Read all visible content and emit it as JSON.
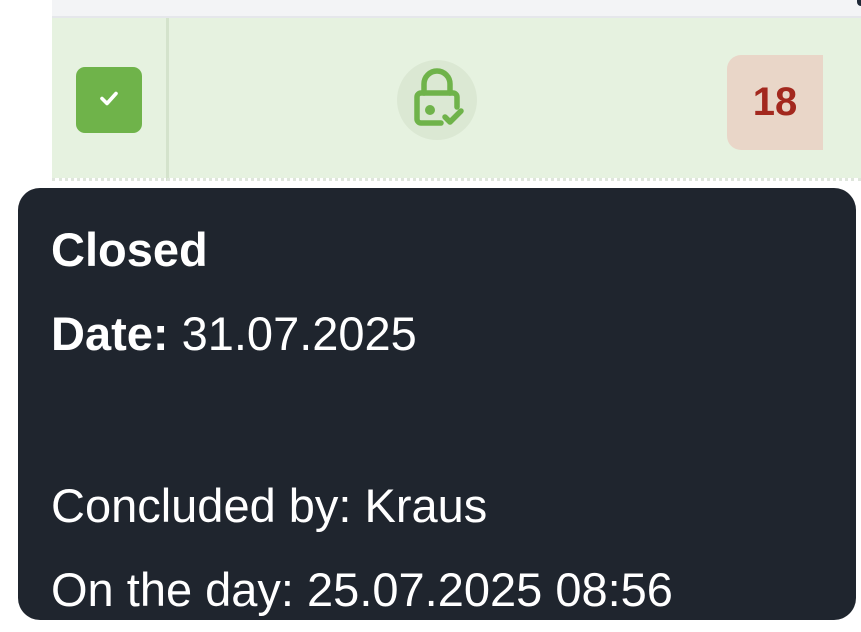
{
  "row": {
    "checkbox": {
      "checked": true,
      "icon": "check-icon",
      "color": "#6fb34a"
    },
    "lock": {
      "icon": "lock-check-icon",
      "color": "#6fb34a"
    },
    "count": "18",
    "colors": {
      "row_bg": "#e6f2e0",
      "badge_bg": "#e9d6c8",
      "badge_text": "#a3281e"
    }
  },
  "tooltip": {
    "status": "Closed",
    "date_label": "Date:",
    "date_value": "31.07.2025",
    "concluded_text": "Concluded by: Kraus",
    "on_day_text": "On the day: 25.07.2025 08:56",
    "colors": {
      "background": "#1f252e",
      "text": "#ffffff"
    }
  }
}
